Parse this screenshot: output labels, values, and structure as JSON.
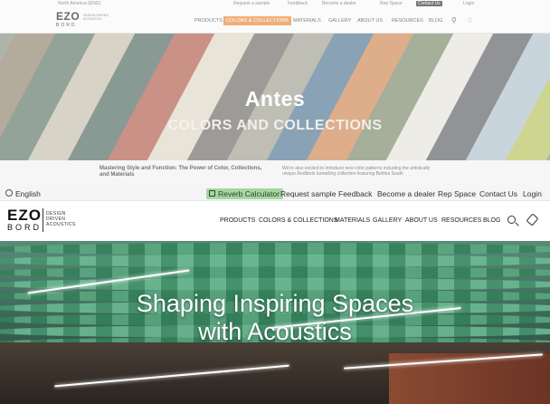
{
  "before": {
    "util_items": [
      "North America (ENG)",
      "Request a sample",
      "Feedback",
      "Become a dealer",
      "Rep Space",
      "Contact Us",
      "Login"
    ],
    "logo": "EZO",
    "logo_sub": "BORD",
    "logo_tagline": "DESIGN DRIVEN ACOUSTICS",
    "nav_items": [
      "PRODUCTS",
      "COLORS & COLLECTIONS",
      "MATERIALS",
      "GALLERY",
      "ABOUT US",
      "RESOURCES",
      "BLOG"
    ],
    "active_nav": "COLORS & COLLECTIONS",
    "label": "Antes",
    "hero_title": "COLORS AND COLLECTIONS",
    "body_heading": "Mastering Style and Function: The Power of Color, Collections, and Materials",
    "body_text": "We're also excited to introduce new color patterns including the artistically unique Redbirds tunnelling collection featuring Bettina South",
    "stripe_colors": [
      "#7a6a4e",
      "#3e5b48",
      "#b8b19a",
      "#2b4a40",
      "#a23b28",
      "#d7cfb7",
      "#4d4c47",
      "#8c8a7b",
      "#2e5a7a",
      "#c46e2f",
      "#5f6f4a",
      "#e1ddd2",
      "#3a3d44",
      "#9fb4c3",
      "#a6b43a"
    ]
  },
  "after": {
    "language": "English",
    "reverb_calculator": "Reverb Calculator",
    "request_sample": "Request sample",
    "feedback": "Feedback",
    "become_dealer": "Become a dealer",
    "rep_space": "Rep Space",
    "contact_us": "Contact Us",
    "login": "Login",
    "logo_top": "EZO",
    "logo_bottom": "BORD",
    "logo_tag": [
      "DESIGN",
      "DRIVEN",
      "ACOUSTICS"
    ],
    "nav": {
      "products": "PRODUCTS",
      "colors": "COLORS & COLLECTIONS",
      "materials": "MATERIALS",
      "gallery": "GALLERY",
      "about": "ABOUT US",
      "resources": "RESOURCES",
      "blog": "BLOG"
    },
    "hero_line1": "Shaping Inspiring Spaces",
    "hero_line2": "with Acoustics"
  },
  "colors": {
    "accent_orange": "#e8883a",
    "reverb_green": "#a8d5a4"
  },
  "icons": [
    "globe-icon",
    "calculator-icon",
    "search-icon",
    "tag-icon"
  ]
}
